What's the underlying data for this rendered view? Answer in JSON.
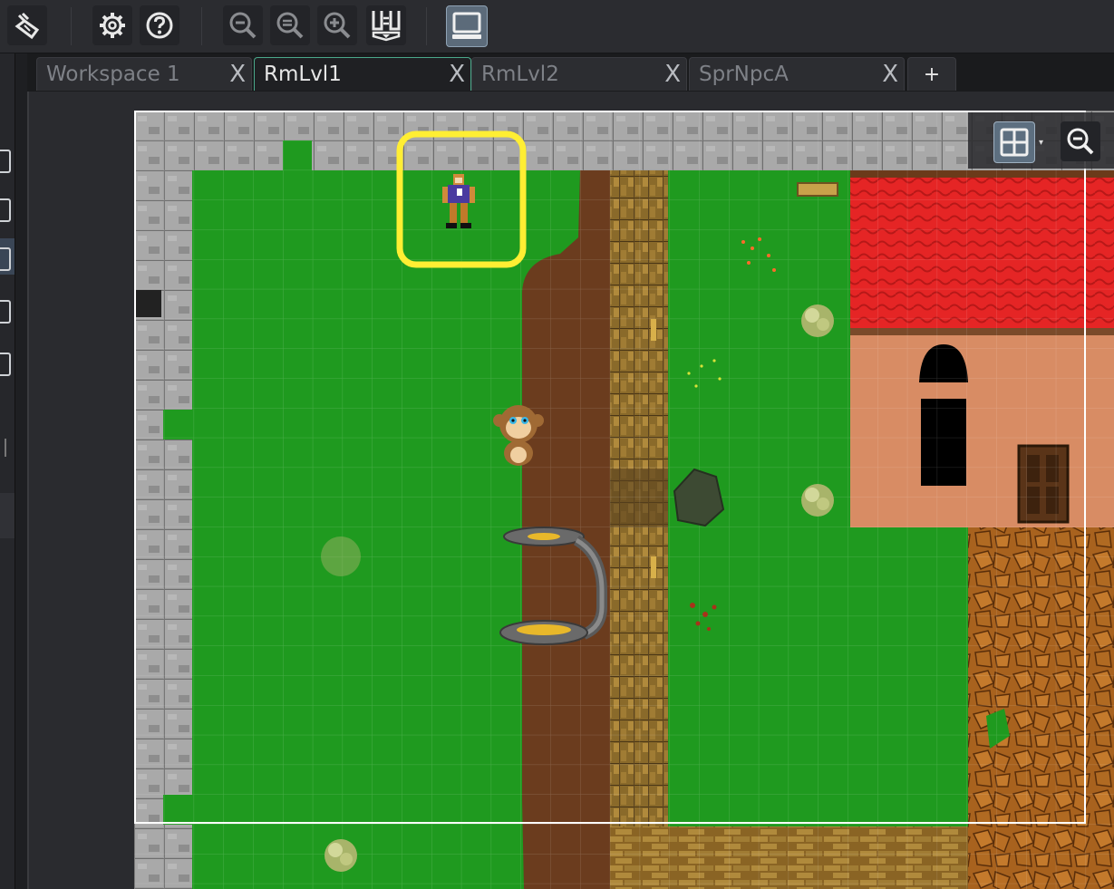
{
  "toolbar": {
    "buttons": [
      {
        "name": "clean-icon"
      },
      {
        "name": "gear-icon"
      },
      {
        "name": "help-icon"
      },
      {
        "name": "zoom-out-icon"
      },
      {
        "name": "zoom-reset-icon"
      },
      {
        "name": "zoom-in-icon"
      },
      {
        "name": "layout-icon"
      },
      {
        "name": "monitor-icon"
      }
    ]
  },
  "tabs": [
    {
      "label": "Workspace 1",
      "active": false
    },
    {
      "label": "RmLvl1",
      "active": true
    },
    {
      "label": "RmLvl2",
      "active": false
    },
    {
      "label": "SprNpcA",
      "active": false
    }
  ],
  "tab_close_glyph": "X",
  "tab_add_glyph": "+",
  "room_view": {
    "name": "RmLvl1",
    "grid_on": true,
    "selection_highlight_color": "#ffee33",
    "grass_color": "#1f9a1f",
    "path_color": "#6b3c1e",
    "roof_color": "#e52525",
    "wall_color": "#d88c64"
  },
  "overlay": {
    "grid_button_icon": "grid-icon",
    "zoom_button_icon": "zoom-out-icon",
    "caret": "▾"
  }
}
